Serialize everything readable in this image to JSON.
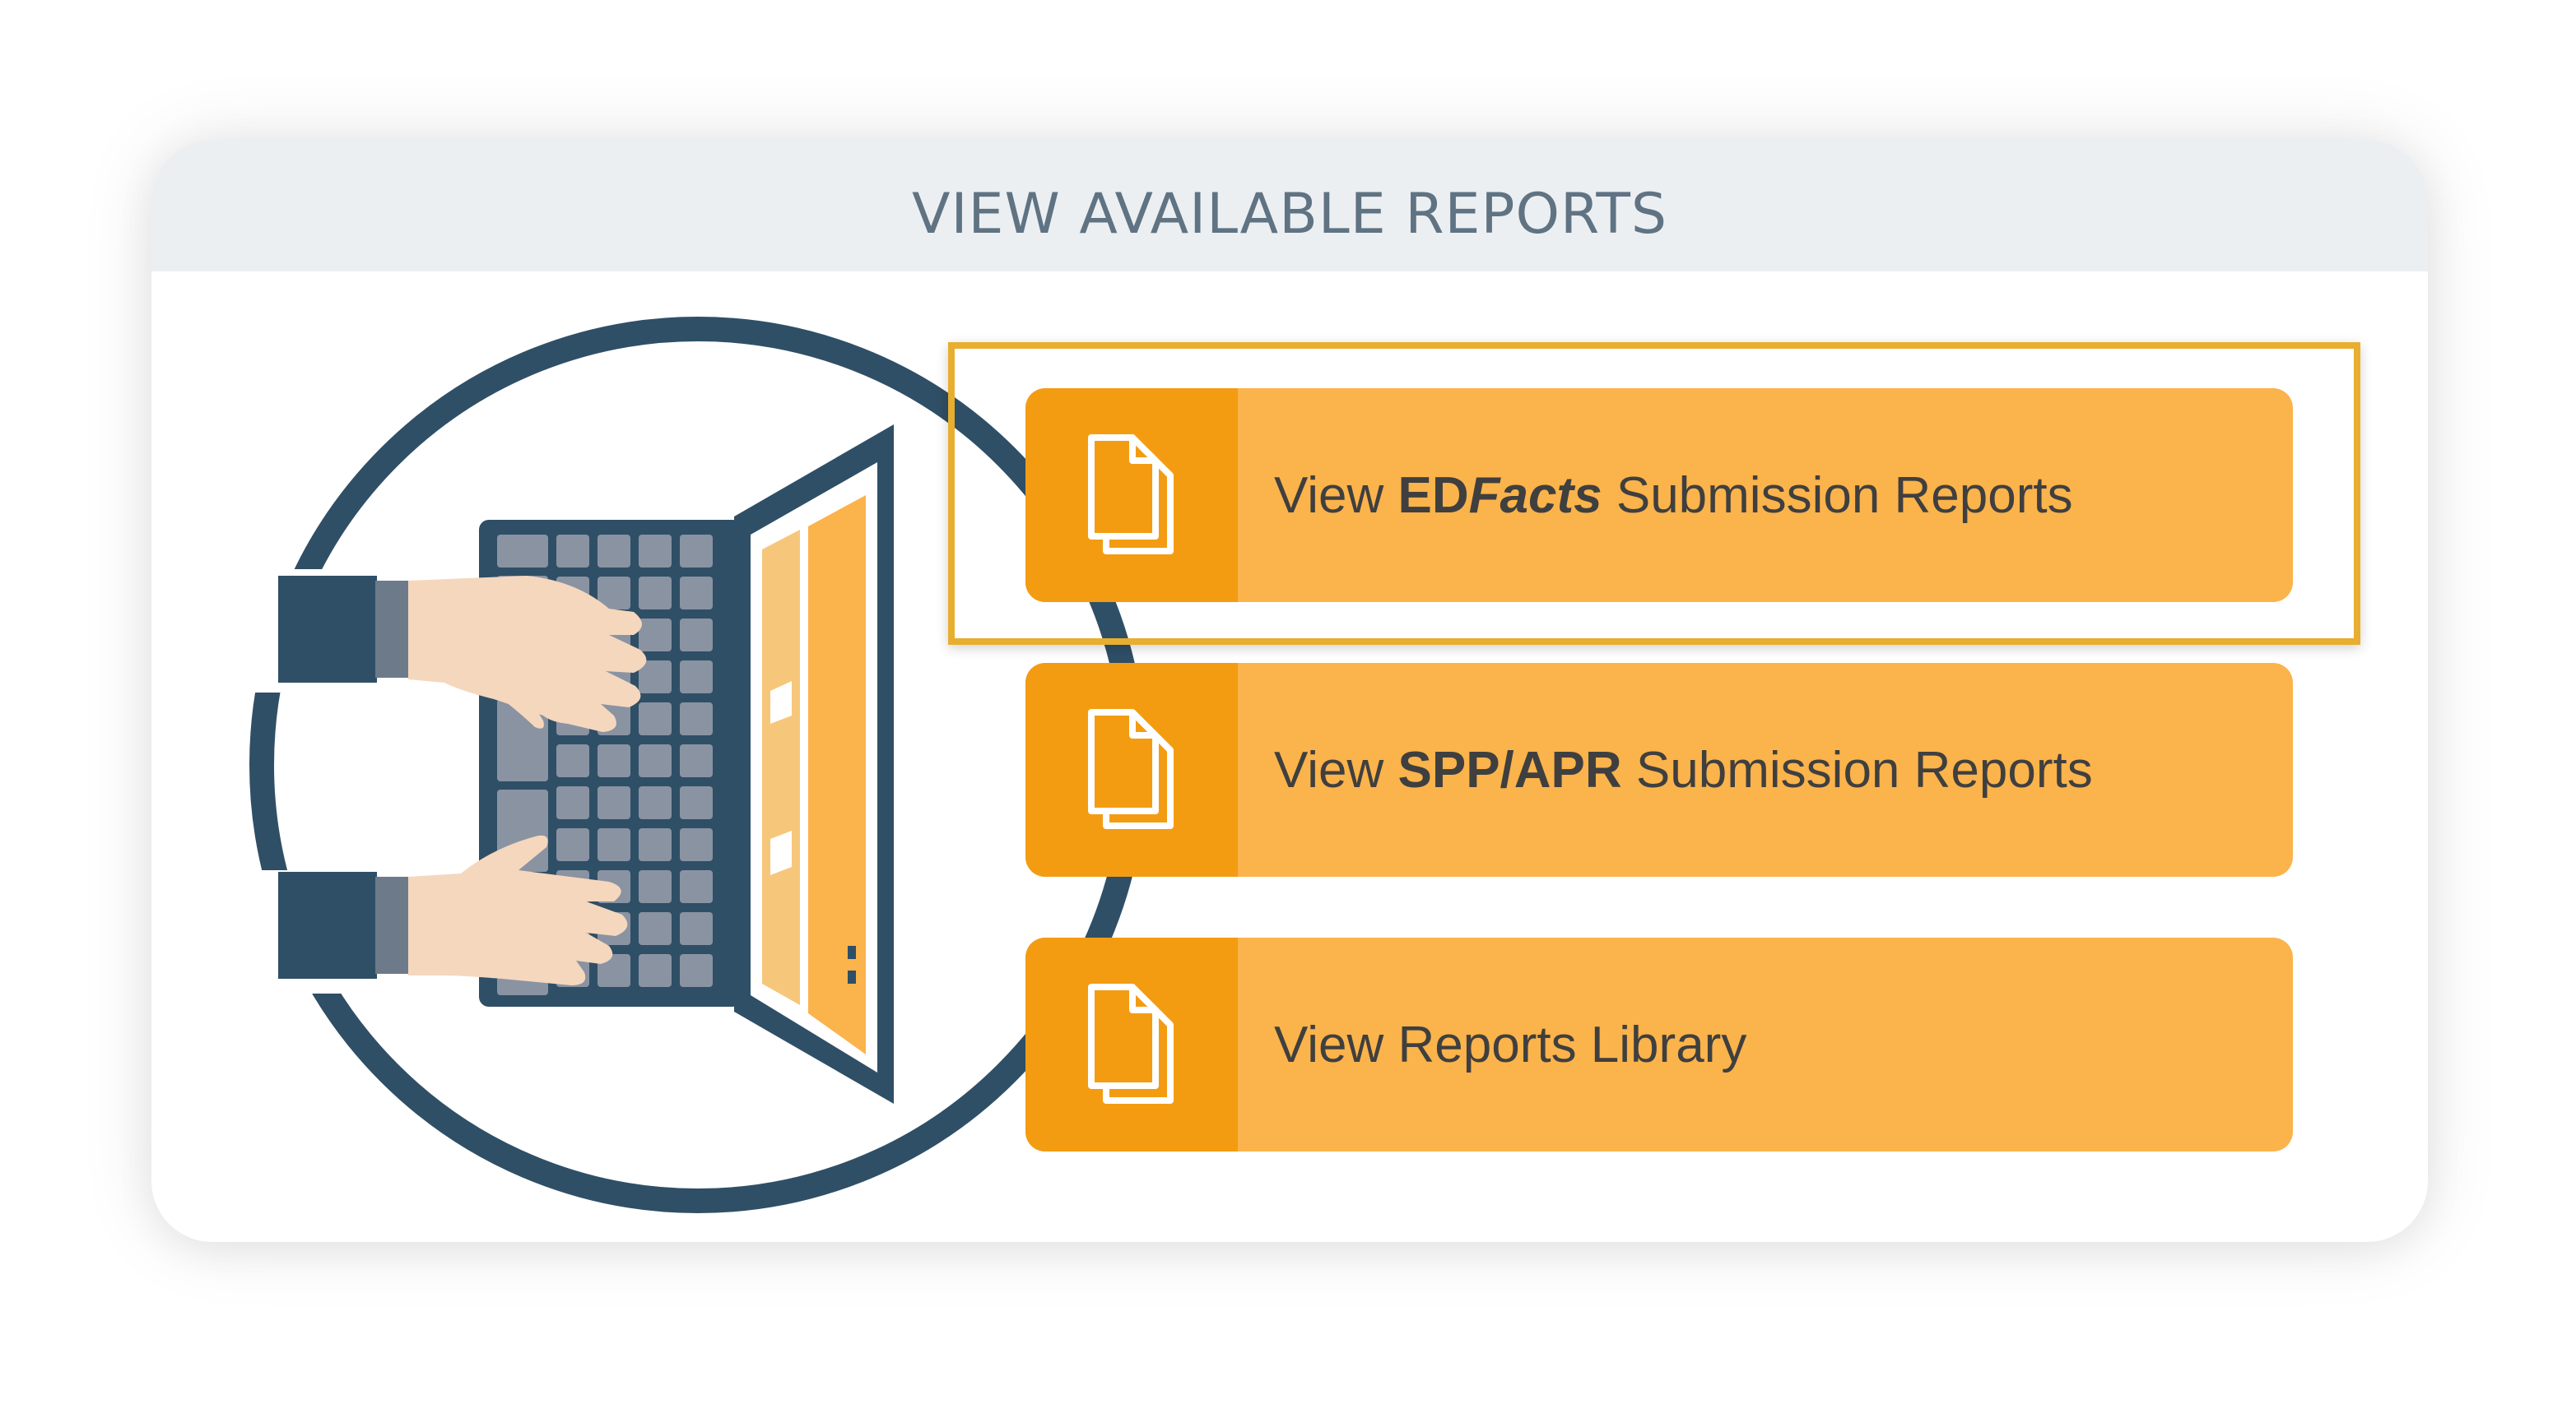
{
  "panel": {
    "title": "VIEW AVAILABLE REPORTS"
  },
  "buttons": [
    {
      "pre": "View ",
      "bold": "ED",
      "bold_italic": "Facts",
      "post": " Submission Reports",
      "icon": "document-stack-icon"
    },
    {
      "pre": "View ",
      "bold": "SPP/APR",
      "post": " Submission Reports",
      "icon": "document-stack-icon"
    },
    {
      "pre": "View Reports Library",
      "icon": "document-stack-icon"
    }
  ],
  "colors": {
    "button_bg": "#fbb34b",
    "icon_bg": "#f39c12",
    "highlight_border": "#e8ae2f",
    "circle": "#2f4f66",
    "header_bg": "#eceff2",
    "title_text": "#5f7383"
  }
}
